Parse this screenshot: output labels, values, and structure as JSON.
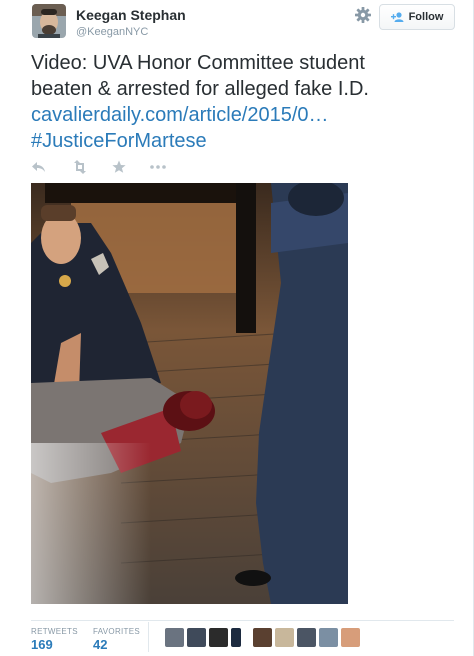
{
  "user": {
    "name": "Keegan Stephan",
    "handle": "@KeeganNYC"
  },
  "follow": {
    "label": "Follow"
  },
  "tweet": {
    "line1": "Video: UVA Honor Committee student",
    "line2": "beaten & arrested for alleged fake I.D.",
    "link": "cavalierdaily.com/article/2015/0…",
    "hashtag": "#JusticeForMartese"
  },
  "actions": {
    "reply_icon": "reply-icon",
    "retweet_icon": "retweet-icon",
    "favorite_icon": "star-icon",
    "more_icon": "more-icon"
  },
  "stats": {
    "retweets_label": "RETWEETS",
    "retweets": "169",
    "favorites_label": "FAVORITES",
    "favorites": "42"
  },
  "colors": {
    "link": "#2b7bb9",
    "text": "#292f33",
    "muted": "#8899a6",
    "border": "#e1e8ed"
  }
}
